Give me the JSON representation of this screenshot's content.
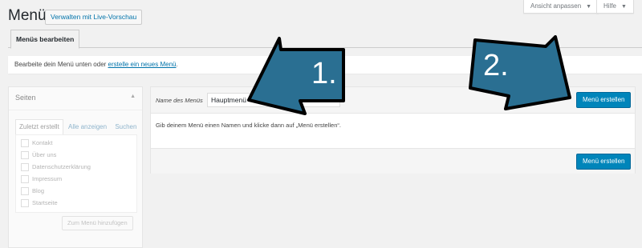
{
  "header": {
    "title": "Menüs",
    "live_preview_button": "Verwalten mit Live-Vorschau",
    "screen_options": "Ansicht anpassen",
    "help": "Hilfe"
  },
  "tabs": {
    "edit_menus": "Menüs bearbeiten"
  },
  "notice": {
    "text_before": "Bearbeite dein Menü unten oder ",
    "link": "erstelle ein neues Menü",
    "text_after": "."
  },
  "sidebar": {
    "title": "Seiten",
    "tabs": [
      "Zuletzt erstellt",
      "Alle anzeigen",
      "Suchen"
    ],
    "items": [
      "Kontakt",
      "Über uns",
      "Datenschutzerklärung",
      "Impressum",
      "Blog",
      "Startseite"
    ],
    "add_button": "Zum Menü hinzufügen"
  },
  "editor": {
    "name_label": "Name des Menüs",
    "name_value": "Hauptmenü",
    "create_button": "Menü erstellen",
    "hint": "Gib deinem Menü einen Namen und klicke dann auf „Menü erstellen“.",
    "create_button_bottom": "Menü erstellen"
  },
  "annotations": {
    "arrow1_label": "1.",
    "arrow2_label": "2.",
    "arrow_color": "#2a6f92"
  }
}
